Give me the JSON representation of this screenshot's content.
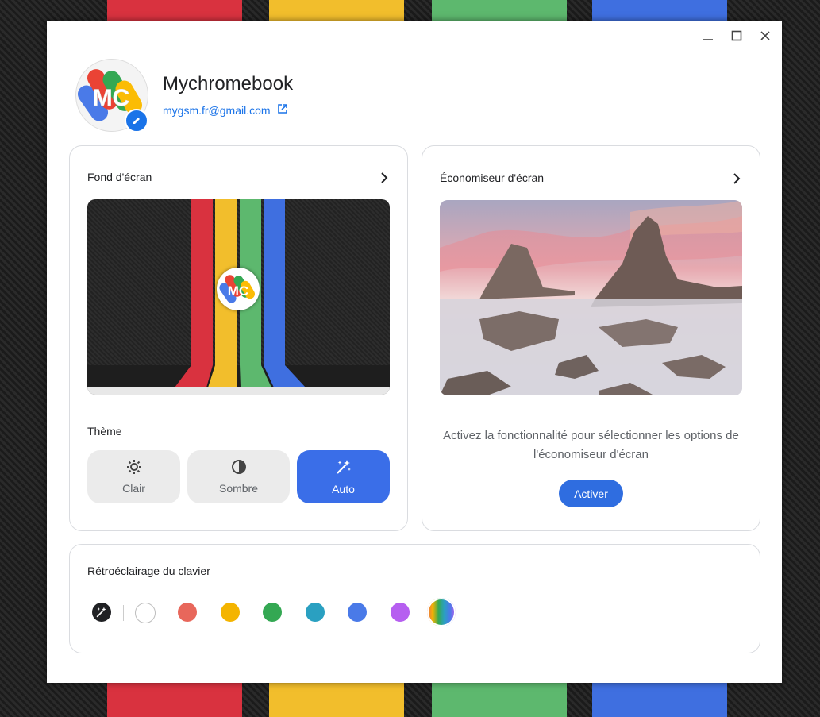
{
  "window": {
    "controls": {
      "minimize": "minimize-icon",
      "maximize": "maximize-icon",
      "close": "close-icon"
    }
  },
  "profile": {
    "device_name": "Mychromebook",
    "email": "mygsm.fr@gmail.com",
    "avatar_letters": "MC",
    "icons": {
      "edit": "pencil-icon",
      "external": "open-in-new-icon"
    }
  },
  "wallpaper": {
    "title": "Fond d'écran",
    "logo_letters": "MC"
  },
  "theme": {
    "title": "Thème",
    "options": [
      {
        "label": "Clair",
        "icon": "gear-sun-icon",
        "active": false
      },
      {
        "label": "Sombre",
        "icon": "half-circle-icon",
        "active": false
      },
      {
        "label": "Auto",
        "icon": "magic-wand-icon",
        "active": true
      }
    ]
  },
  "screensaver": {
    "title": "Économiseur d'écran",
    "message": "Activez la fonctionnalité pour sélectionner les options de l'économiseur d'écran",
    "button": "Activer"
  },
  "keyboard_backlight": {
    "title": "Rétroéclairage du clavier",
    "colors": [
      "#ffffff",
      "#e8675b",
      "#f4b400",
      "#34a853",
      "#2aa0c1",
      "#4a7ae8",
      "#b65ff0"
    ],
    "accent": "#3a6ee8"
  }
}
